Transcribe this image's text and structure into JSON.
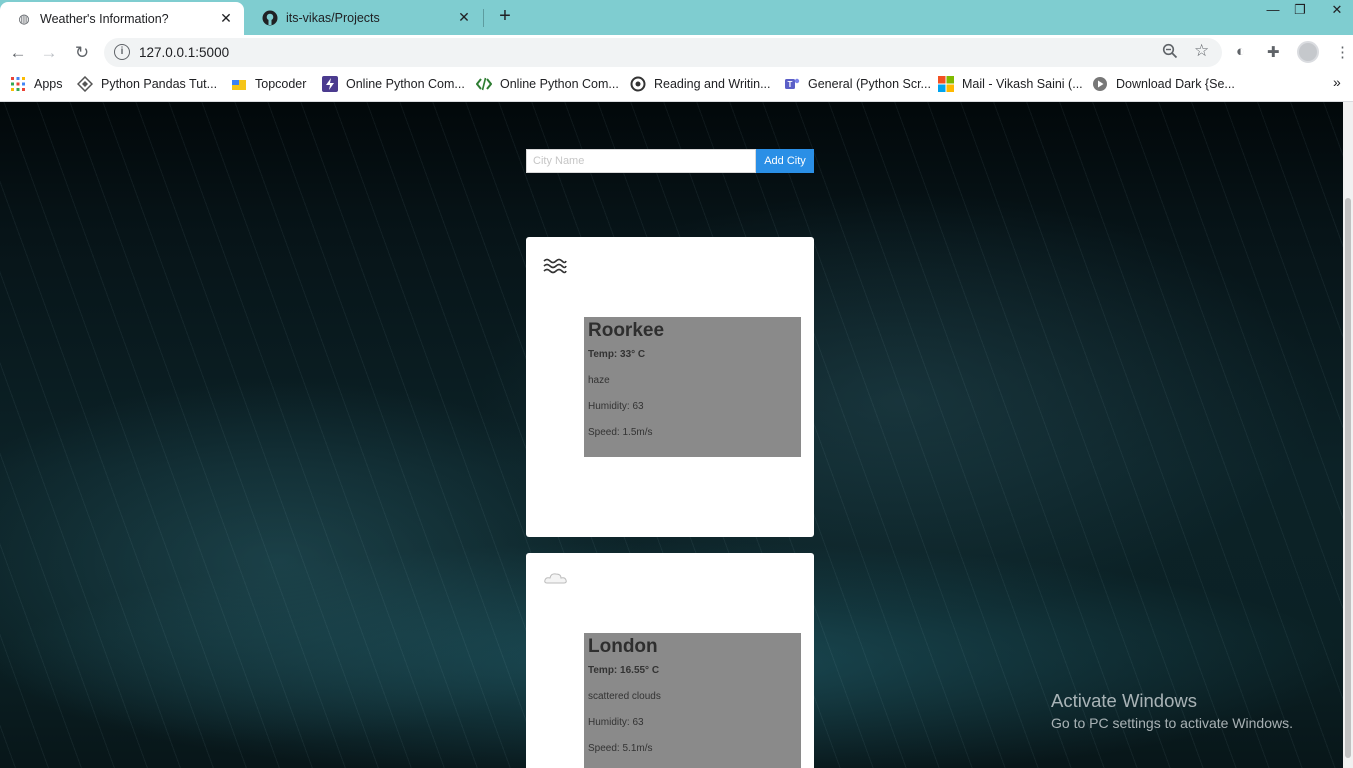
{
  "tabs": [
    {
      "title": "Weather's Information?",
      "icon": "globe-icon"
    },
    {
      "title": "its-vikas/Projects",
      "icon": "github-icon"
    }
  ],
  "window_controls": {
    "minimize": "—",
    "restore": "❐",
    "close": "✕"
  },
  "address_bar": {
    "url": "127.0.0.1:5000"
  },
  "bookmarks": [
    {
      "label": "Apps",
      "icon": "apps-grid-icon"
    },
    {
      "label": "Python Pandas Tut...",
      "icon": "diamond-icon"
    },
    {
      "label": "Topcoder",
      "icon": "topcoder-icon"
    },
    {
      "label": "Online Python Com...",
      "icon": "bolt-icon"
    },
    {
      "label": "Online Python Com...",
      "icon": "code-icon"
    },
    {
      "label": "Reading and Writin...",
      "icon": "circle-icon"
    },
    {
      "label": "General (Python Scr...",
      "icon": "teams-icon"
    },
    {
      "label": "Mail - Vikash Saini (...",
      "icon": "microsoft-icon"
    },
    {
      "label": "Download Dark {Se...",
      "icon": "play-icon"
    }
  ],
  "form": {
    "placeholder": "City Name",
    "button": "Add City"
  },
  "cities": [
    {
      "name": "Roorkee",
      "temp": "Temp: 33° C",
      "description": "haze",
      "humidity": "Humidity: 63",
      "speed": "Speed: 1.5m/s",
      "icon": "haze-icon"
    },
    {
      "name": "London",
      "temp": "Temp: 16.55° C",
      "description": "scattered clouds",
      "humidity": "Humidity: 63",
      "speed": "Speed: 5.1m/s",
      "icon": "cloud-icon"
    }
  ],
  "watermark": {
    "title": "Activate Windows",
    "subtitle": "Go to PC settings to activate Windows."
  }
}
